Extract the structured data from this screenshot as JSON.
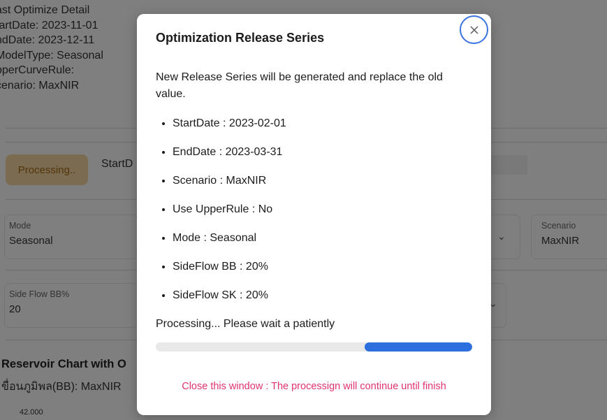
{
  "background": {
    "detail": {
      "title": "ast Optimize Detail",
      "lines": [
        "tartDate: 2023-11-01",
        "ndDate: 2023-12-11",
        "ModelType: Seasonal",
        "pperCurveRule:",
        "cenario: MaxNIR"
      ]
    },
    "processing_button": "Processing..",
    "start_label": "StartD",
    "mode": {
      "label": "Mode",
      "value": "Seasonal"
    },
    "scenario": {
      "label": "Scenario",
      "value": "MaxNIR"
    },
    "side_flow": {
      "label": "Side Flow BB%",
      "value": "20"
    },
    "chart_title": "Reservoir Chart with O",
    "chart_subtitle": "ขื่อนภูมิพล(BB): MaxNIR",
    "y_tick": "42.000"
  },
  "modal": {
    "title": "Optimization Release Series",
    "description": "New Release Series will be generated and replace the old value.",
    "params": [
      "StartDate : 2023-02-01",
      "EndDate : 2023-03-31",
      "Scenario : MaxNIR",
      "Use UpperRule : No",
      "Mode : Seasonal",
      "SideFlow BB : 20%",
      "SideFlow SK : 20%"
    ],
    "status": "Processing... Please wait a patiently",
    "progress": 0.34,
    "close_note": "Close this window : The processign will continue until finish"
  },
  "colors": {
    "accent": "#2e6fe0",
    "warning_text": "#e0336c",
    "processing_button_bg": "#f7d6a3"
  }
}
